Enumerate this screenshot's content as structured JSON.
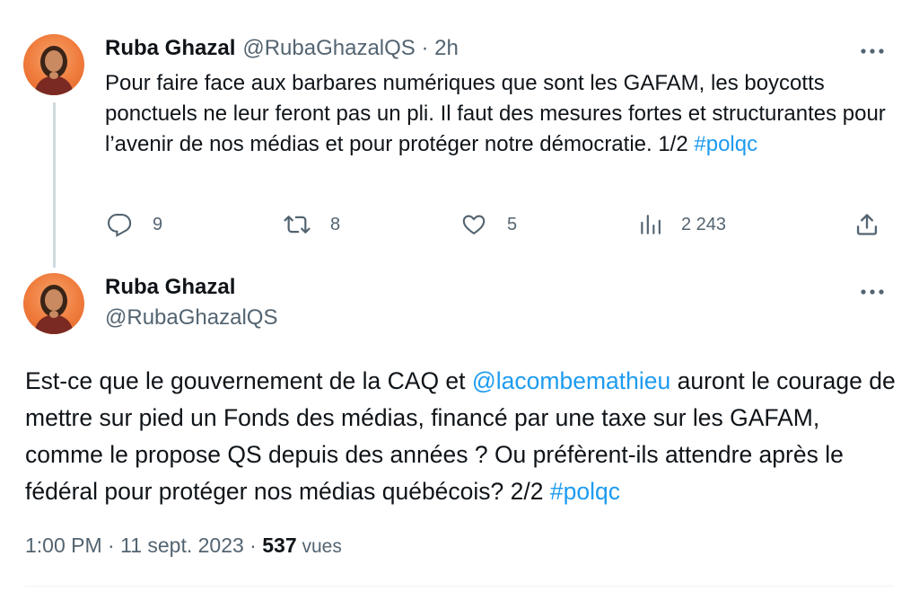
{
  "tweet1": {
    "author_name": "Ruba Ghazal",
    "author_handle": "@RubaGhazalQS",
    "separator": " · ",
    "time_ago": "2h",
    "text_before": "Pour faire face aux barbares numériques que sont les GAFAM, les boycotts ponctuels ne leur feront pas un pli. Il faut des mesures fortes et structurantes pour l’avenir de nos médias et pour protéger notre démocratie. 1/2 ",
    "hashtag": "#polqc",
    "replies": "9",
    "retweets": "8",
    "likes": "5",
    "views": "2 243"
  },
  "tweet2": {
    "author_name": "Ruba Ghazal",
    "author_handle": "@RubaGhazalQS",
    "text_part1": "Est-ce que le gouvernement de la CAQ et ",
    "mention": "@lacombemathieu",
    "text_part2": " auront le courage de mettre sur pied un Fonds des médias, financé par une taxe sur les GAFAM, comme le propose QS depuis des années ? Ou préfèrent-ils attendre après le fédéral pour protéger nos médias québécois? 2/2 ",
    "hashtag": "#polqc",
    "time": "1:00 PM",
    "dot": " · ",
    "date": "11 sept. 2023",
    "dot2": " · ",
    "view_count": "537",
    "views_label": " vues"
  },
  "icons": {
    "more": "more-horizontal-icon",
    "reply": "reply-bubble-icon",
    "retweet": "retweet-icon",
    "like": "heart-icon",
    "views": "analytics-bar-icon",
    "share": "share-upload-icon"
  },
  "colors": {
    "link": "#1d9bf0",
    "secondary_text": "#536471",
    "primary_text": "#0f1419",
    "thread_line": "#cfd9de",
    "avatar_bg": "#ef7b3c"
  }
}
